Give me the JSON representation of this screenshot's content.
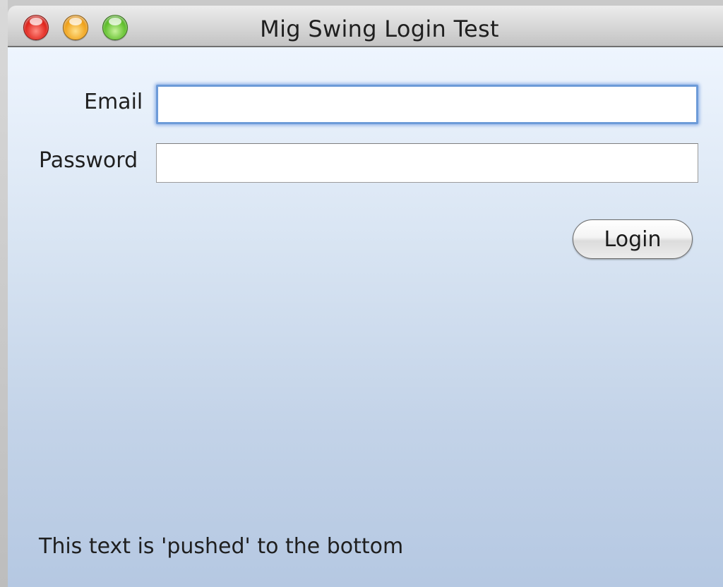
{
  "window": {
    "title": "Mig Swing Login Test",
    "controls": {
      "close_icon": "close-icon",
      "minimize_icon": "minimize-icon",
      "zoom_icon": "zoom-icon"
    }
  },
  "form": {
    "email_label": "Email",
    "email_value": "",
    "password_label": "Password",
    "password_value": "",
    "login_label": "Login"
  },
  "footer": {
    "text": "This text is 'pushed' to the bottom"
  },
  "colors": {
    "focus_ring": "#6d9bd8",
    "close": "#e0241b",
    "minimize": "#f0a21a",
    "zoom": "#5fbf2b"
  }
}
